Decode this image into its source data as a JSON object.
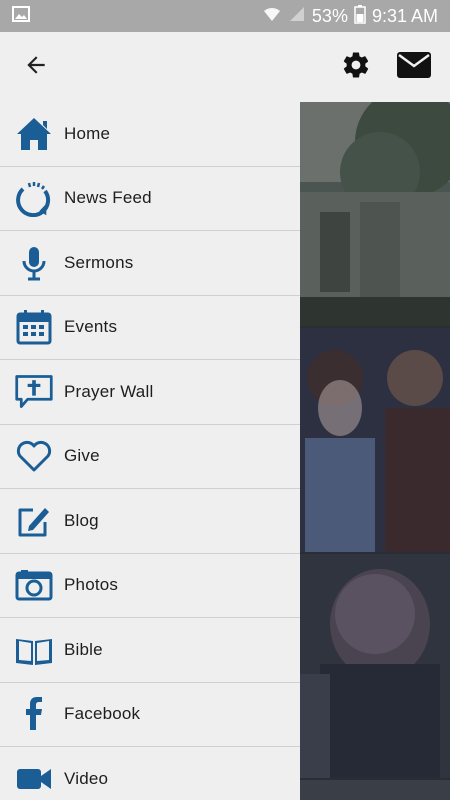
{
  "status_bar": {
    "battery": "53%",
    "time": "9:31 AM"
  },
  "menu": {
    "items": [
      {
        "label": "Home"
      },
      {
        "label": "News Feed"
      },
      {
        "label": "Sermons"
      },
      {
        "label": "Events"
      },
      {
        "label": "Prayer Wall"
      },
      {
        "label": "Give"
      },
      {
        "label": "Blog"
      },
      {
        "label": "Photos"
      },
      {
        "label": "Bible"
      },
      {
        "label": "Facebook"
      },
      {
        "label": "Video"
      }
    ]
  },
  "colors": {
    "accent": "#1a5e95",
    "drawer_bg": "#efefef",
    "status_bar": "#a8a8a8"
  },
  "icons": {
    "back": "arrow-left-icon",
    "settings": "gear-icon",
    "mail": "envelope-icon"
  }
}
